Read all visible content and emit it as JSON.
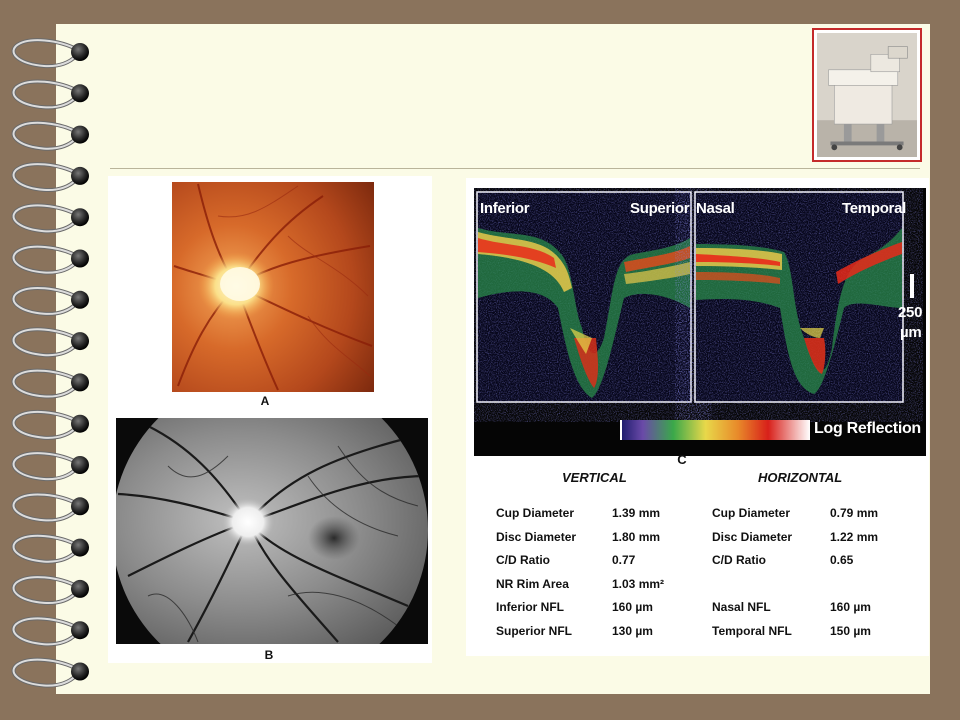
{
  "figure_a": {
    "label": "A"
  },
  "figure_b": {
    "label": "B"
  },
  "figure_c": {
    "label": "C",
    "scan_labels": {
      "inferior": "Inferior",
      "superior": "Superior",
      "nasal": "Nasal",
      "temporal": "Temporal"
    },
    "scale_value": "250",
    "scale_unit": "µm",
    "colorbar_label": "Log Reflection"
  },
  "measurements": {
    "vertical": {
      "heading": "VERTICAL",
      "rows": [
        {
          "label": "Cup Diameter",
          "value": "1.39 mm"
        },
        {
          "label": "Disc Diameter",
          "value": "1.80 mm"
        },
        {
          "label": "C/D Ratio",
          "value": "0.77"
        },
        {
          "label": "NR Rim Area",
          "value": "1.03 mm²"
        },
        {
          "label": "Inferior NFL",
          "value": "160 µm"
        },
        {
          "label": "Superior NFL",
          "value": "130 µm"
        }
      ]
    },
    "horizontal": {
      "heading": "HORIZONTAL",
      "rows": [
        {
          "label": "Cup Diameter",
          "value": "0.79 mm"
        },
        {
          "label": "Disc Diameter",
          "value": "1.22 mm"
        },
        {
          "label": "C/D Ratio",
          "value": "0.65"
        },
        {
          "label": "Nasal NFL",
          "value": "160 µm"
        },
        {
          "label": "Temporal NFL",
          "value": "150 µm"
        }
      ]
    }
  },
  "colors": {
    "background": "#8a735c",
    "slide": "#fbfbe6",
    "thumbnail_border": "#c42a2a"
  }
}
